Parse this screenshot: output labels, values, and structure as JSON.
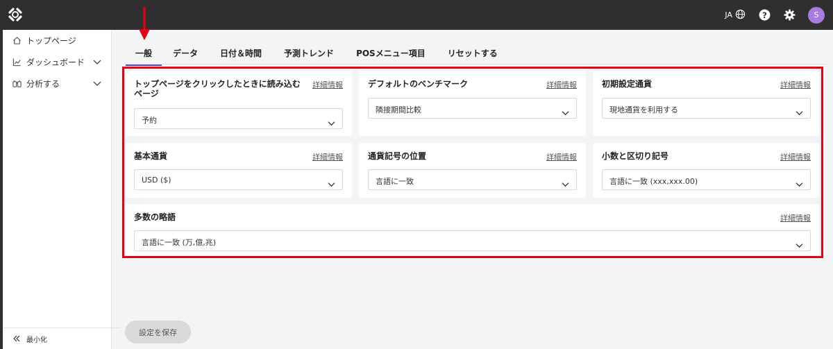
{
  "topbar": {
    "lang": "JA",
    "avatar_initial": "S"
  },
  "sidebar": {
    "items": [
      {
        "label": "トップページ",
        "icon": "home-icon"
      },
      {
        "label": "ダッシュボード",
        "icon": "chart-icon"
      },
      {
        "label": "分析する",
        "icon": "binoculars-icon"
      }
    ],
    "minimize_label": "最小化"
  },
  "tabs": [
    "一般",
    "データ",
    "日付＆時間",
    "予測トレンド",
    "POSメニュー項目",
    "リセットする"
  ],
  "active_tab": "一般",
  "details_label": "詳細情報",
  "cards": {
    "top_page": {
      "title": "トップページをクリックしたときに読み込むページ",
      "value": "予約"
    },
    "benchmark": {
      "title": "デフォルトのベンチマーク",
      "value": "隣接期間比較"
    },
    "initial_currency": {
      "title": "初期設定通貨",
      "value": "現地通貨を利用する"
    },
    "base_currency": {
      "title": "基本通貨",
      "value": "USD ($)"
    },
    "currency_symbol": {
      "title": "通貨記号の位置",
      "value": "言語に一致"
    },
    "decimal_separator": {
      "title": "小数と区切り記号",
      "value": "言語に一致 (xxx,xxx.00)"
    },
    "large_number": {
      "title": "多数の略語",
      "value": "言語に一致 (万,億,兆)"
    }
  },
  "save_label": "設定を保存",
  "colors": {
    "accent": "#6a3fc7",
    "annotation": "#e60012",
    "topbar": "#2f2f2f"
  }
}
